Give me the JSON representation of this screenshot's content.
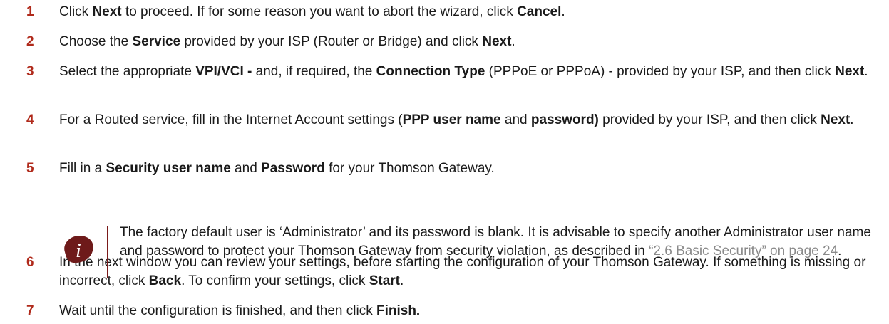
{
  "steps": [
    {
      "number": "1",
      "segments": [
        {
          "t": "Click ",
          "b": false
        },
        {
          "t": "Next",
          "b": true
        },
        {
          "t": " to proceed. If for some reason you want to abort the wizard, click ",
          "b": false
        },
        {
          "t": "Cancel",
          "b": true
        },
        {
          "t": ".",
          "b": false
        }
      ]
    },
    {
      "number": "2",
      "segments": [
        {
          "t": "Choose the ",
          "b": false
        },
        {
          "t": "Service",
          "b": true
        },
        {
          "t": " provided by your ISP (Router or Bridge) and click ",
          "b": false
        },
        {
          "t": "Next",
          "b": true
        },
        {
          "t": ".",
          "b": false
        }
      ]
    },
    {
      "number": "3",
      "segments": [
        {
          "t": "Select the appropriate ",
          "b": false
        },
        {
          "t": "VPI/VCI -",
          "b": true
        },
        {
          "t": " and, if required, the ",
          "b": false
        },
        {
          "t": "Connection Type",
          "b": true
        },
        {
          "t": " (PPPoE or PPPoA) - provided by your ISP, and then click ",
          "b": false
        },
        {
          "t": "Next",
          "b": true
        },
        {
          "t": ".",
          "b": false
        }
      ]
    },
    {
      "number": "4",
      "segments": [
        {
          "t": "For a Routed service, fill in the Internet Account settings (",
          "b": false
        },
        {
          "t": "PPP user name",
          "b": true
        },
        {
          "t": " and ",
          "b": false
        },
        {
          "t": "password)",
          "b": true
        },
        {
          "t": " provided by your ISP, and then click ",
          "b": false
        },
        {
          "t": "Next",
          "b": true
        },
        {
          "t": ".",
          "b": false
        }
      ]
    },
    {
      "number": "5",
      "segments": [
        {
          "t": "Fill in a ",
          "b": false
        },
        {
          "t": "Security user name",
          "b": true
        },
        {
          "t": " and ",
          "b": false
        },
        {
          "t": "Password",
          "b": true
        },
        {
          "t": " for your Thomson Gateway.",
          "b": false
        }
      ]
    },
    {
      "number": "6",
      "segments": [
        {
          "t": "In the next window you can review your settings, before starting the configuration of your Thomson Gateway. If something is missing or incorrect, click ",
          "b": false
        },
        {
          "t": "Back",
          "b": true
        },
        {
          "t": ". To confirm your settings, click ",
          "b": false
        },
        {
          "t": "Start",
          "b": true
        },
        {
          "t": ".",
          "b": false
        }
      ]
    },
    {
      "number": "7",
      "segments": [
        {
          "t": "Wait until the configuration is finished, and then click ",
          "b": false
        },
        {
          "t": "Finish.",
          "b": true
        }
      ]
    }
  ],
  "note": {
    "icon": "info-icon",
    "text_before": "The factory default user is ‘Administrator’ and its password is blank. It is advisable to specify another Administrator user name and password to protect your Thomson Gateway from security violation, as described in ",
    "xref": "“2.6 Basic Security” on page 24",
    "text_after": "."
  },
  "colors": {
    "step_number": "#b02a1b",
    "icon_fill": "#6e1a1a",
    "xref": "#8a8a8a"
  }
}
